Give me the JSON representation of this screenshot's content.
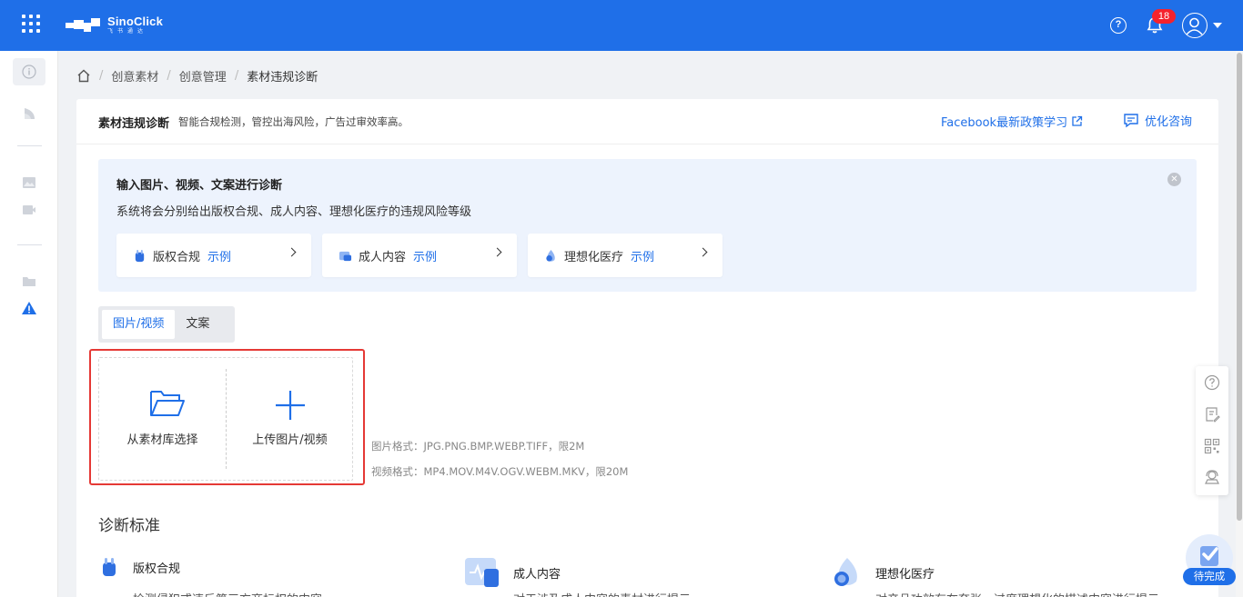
{
  "header": {
    "logo_name": "SinoClick",
    "logo_sub": "飞书通达",
    "notification_count": "18"
  },
  "breadcrumb": [
    "创意素材",
    "创意管理",
    "素材违规诊断"
  ],
  "card": {
    "title": "素材违规诊断",
    "subtitle": "智能合规检测，管控出海风险，广告过审效率高。",
    "facebook_link": "Facebook最新政策学习",
    "consult_label": "优化咨询"
  },
  "banner": {
    "title": "输入图片、视频、文案进行诊断",
    "description": "系统将会分别给出版权合规、成人内容、理想化医疗的违规风险等级",
    "categories": [
      {
        "label": "版权合规",
        "example": "示例"
      },
      {
        "label": "成人内容",
        "example": "示例"
      },
      {
        "label": "理想化医疗",
        "example": "示例"
      }
    ]
  },
  "tabs": [
    "图片/视频",
    "文案"
  ],
  "upload": {
    "from_library": "从素材库选择",
    "upload_label": "上传图片/视频",
    "image_format": "图片格式：JPG.PNG.BMP.WEBP.TIFF，限2M",
    "video_format": "视频格式：MP4.MOV.M4V.OGV.WEBM.MKV，限20M"
  },
  "standards": {
    "title": "诊断标准",
    "items": [
      {
        "label": "版权合规",
        "desc": "检测侵犯或违反第三方商标权的内容"
      },
      {
        "label": "成人内容",
        "desc": "对于涉及成人内容的素材进行提示"
      },
      {
        "label": "理想化医疗",
        "desc": "对产品功效存在夸张、过度理想化的描述内容进行提示"
      }
    ]
  },
  "pending_label": "待完成",
  "colors": {
    "brand": "#1f6fe8",
    "highlight": "#e53935",
    "badge": "#f5222d"
  }
}
